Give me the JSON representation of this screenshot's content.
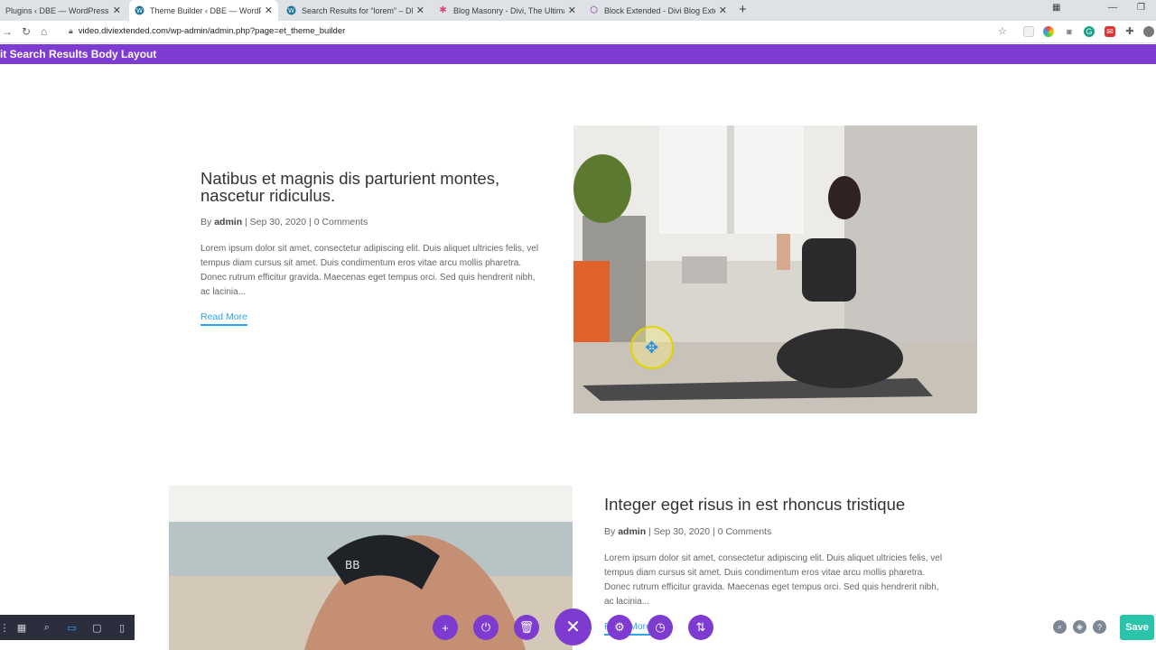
{
  "browser": {
    "tabs": [
      {
        "title": "Plugins ‹ DBE — WordPress",
        "icon": "wordpress-icon"
      },
      {
        "title": "Theme Builder ‹ DBE — WordPress",
        "icon": "wordpress-icon"
      },
      {
        "title": "Search Results for “lorem” – DBE",
        "icon": "wordpress-icon"
      },
      {
        "title": "Blog Masonry - Divi, The Ultimate",
        "icon": "gear-icon"
      },
      {
        "title": "Block Extended - Divi Blog Extended",
        "icon": "shield-icon"
      }
    ],
    "url": "video.diviextended.com/wp-admin/admin.php?page=et_theme_builder"
  },
  "builder": {
    "title": "it Search Results Body Layout",
    "save_label": "Save"
  },
  "posts": [
    {
      "title": "Natibus et magnis dis parturient montes, nascetur ridiculus.",
      "by": "By",
      "author": "admin",
      "meta_rest": " | Sep 30, 2020 | 0 Comments",
      "excerpt": "Lorem ipsum dolor sit amet, consectetur adipiscing elit. Duis aliquet ultricies felis, vel tempus diam cursus sit amet. Duis condimentum eros vitae arcu mollis pharetra. Donec rutrum efficitur gravida. Maecenas eget tempus orci. Sed quis hendrerit nibh, ac lacinia...",
      "read_more": "Read More"
    },
    {
      "title": "Integer eget risus in est rhoncus tristique",
      "by": "By",
      "author": "admin",
      "meta_rest": " | Sep 30, 2020 | 0 Comments",
      "excerpt": "Lorem ipsum dolor sit amet, consectetur adipiscing elit. Duis aliquet ultricies felis, vel tempus diam cursus sit amet. Duis condimentum eros vitae arcu mollis pharetra. Donec rutrum efficitur gravida. Maecenas eget tempus orci. Sed quis hendrerit nibh, ac lacinia...",
      "read_more": "Read More"
    }
  ],
  "colors": {
    "accent": "#7e3bd0",
    "link": "#2ea3f2",
    "save": "#29c4a9"
  }
}
